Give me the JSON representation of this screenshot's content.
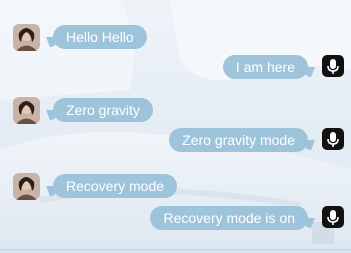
{
  "colors": {
    "bubble": "#9ec4db",
    "bubble_text": "#ffffff",
    "mic_bg": "#111111",
    "mic_icon": "#ffffff"
  },
  "messages": [
    {
      "side": "left",
      "text": "Hello Hello",
      "icon": "avatar"
    },
    {
      "side": "right",
      "text": "I am here",
      "icon": "microphone-icon"
    },
    {
      "side": "left",
      "text": "Zero gravity",
      "icon": "avatar"
    },
    {
      "side": "right",
      "text": "Zero gravity mode",
      "icon": "microphone-icon"
    },
    {
      "side": "left",
      "text": "Recovery mode",
      "icon": "avatar"
    },
    {
      "side": "right",
      "text": "Recovery mode is on",
      "icon": "microphone-icon"
    }
  ]
}
